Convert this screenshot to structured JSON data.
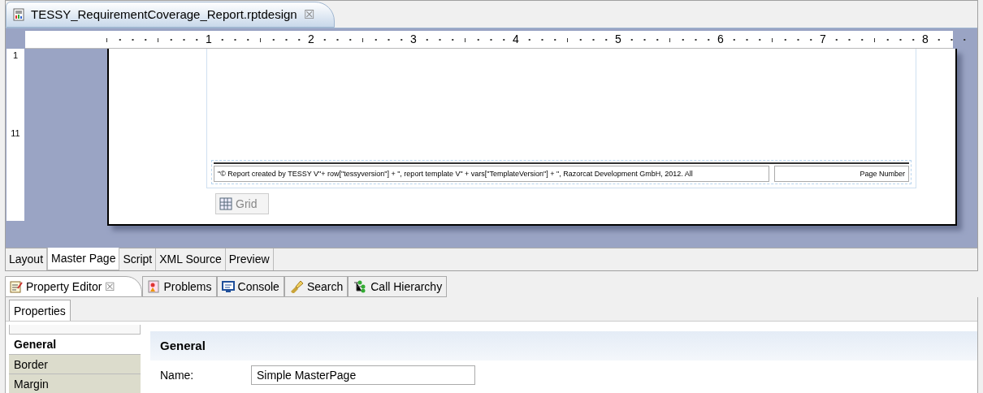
{
  "editor_tab": {
    "title": "TESSY_RequirementCoverage_Report.rptdesign",
    "close": "☒"
  },
  "ruler": {
    "horizontal": [
      "1",
      "2",
      "3",
      "4",
      "5",
      "6",
      "7",
      "8"
    ],
    "vertical": [
      "1",
      "11"
    ]
  },
  "page": {
    "footer_text": "\"© Report created by TESSY V\"+ row[\"tessyversion\"] + \", report template V\" + vars[\"TemplateVersion\"] + \", Razorcat Development GmbH, 2012. All",
    "page_number": "Page Number",
    "grid_label": "Grid"
  },
  "editor_pages": [
    {
      "label": "Layout",
      "selected": false
    },
    {
      "label": "Master Page",
      "selected": true
    },
    {
      "label": "Script",
      "selected": false
    },
    {
      "label": "XML Source",
      "selected": false
    },
    {
      "label": "Preview",
      "selected": false
    }
  ],
  "views": [
    {
      "label": "Property Editor",
      "kind": "property",
      "selected": true,
      "close": "☒"
    },
    {
      "label": "Problems",
      "kind": "problems",
      "selected": false
    },
    {
      "label": "Console",
      "kind": "console",
      "selected": false
    },
    {
      "label": "Search",
      "kind": "search",
      "selected": false
    },
    {
      "label": "Call Hierarchy",
      "kind": "hierarchy",
      "selected": false
    }
  ],
  "properties_tab": "Properties",
  "sections": [
    {
      "label": "General",
      "selected": true
    },
    {
      "label": "Border",
      "selected": false
    },
    {
      "label": "Margin",
      "selected": false
    }
  ],
  "general": {
    "heading": "General",
    "name_label": "Name:",
    "name_value": "Simple MasterPage"
  }
}
